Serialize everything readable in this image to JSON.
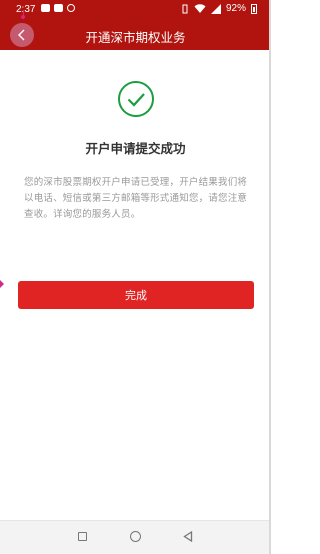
{
  "status_bar": {
    "time": "2:37",
    "battery_percent": "92%"
  },
  "header": {
    "title": "开通深市期权业务",
    "back_icon": "chevron-left-icon"
  },
  "result": {
    "icon": "check-circle-icon",
    "icon_color": "#1a9e3f",
    "title": "开户申请提交成功",
    "description": "您的深市股票期权开户申请已受理，开户结果我们将以电话、短信或第三方邮箱等形式通知您，请您注意查收。详询您的服务人员。"
  },
  "actions": {
    "done_label": "完成"
  },
  "nav_bar": {
    "recents_icon": "square-icon",
    "home_icon": "circle-icon",
    "back_icon": "triangle-back-icon"
  },
  "colors": {
    "header_bg": "#b1140f",
    "button_bg": "#e02424",
    "text_primary": "#333333",
    "text_secondary": "#999999"
  }
}
